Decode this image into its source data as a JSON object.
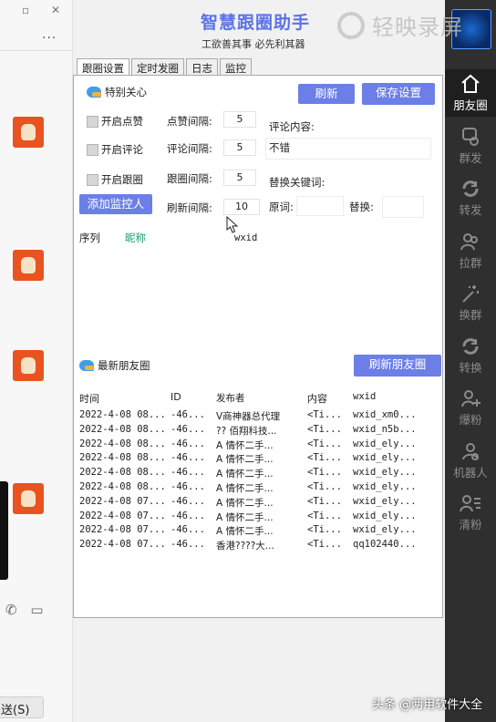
{
  "left_window": {
    "dots": "...",
    "send_button": "送(S)"
  },
  "app": {
    "title": "智慧跟圈助手",
    "subtitle": "工欲善其事 必先利其器"
  },
  "tabs": [
    "跟圈设置",
    "定时发圈",
    "日志",
    "监控"
  ],
  "special_care": {
    "header": "特别关心",
    "refresh_button": "刷新",
    "save_button": "保存设置",
    "like": {
      "label": "开启点赞",
      "interval_label": "点赞间隔:",
      "interval": "5"
    },
    "comment": {
      "label": "开启评论",
      "interval_label": "评论间隔:",
      "interval": "5"
    },
    "follow": {
      "label": "开启跟圈",
      "interval_label": "跟圈间隔:",
      "interval": "5"
    },
    "add_monitor_button": "添加监控人",
    "refresh_interval_label": "刷新间隔:",
    "refresh_interval": "10",
    "comment_content_label": "评论内容:",
    "comment_content": "不错",
    "replace_keyword_label": "替换关键词:",
    "original_label": "原词:",
    "original_value": "",
    "replace_label": "替换:",
    "replace_value": "",
    "list_columns": [
      "序列",
      "昵称",
      "wxid"
    ]
  },
  "latest_moments": {
    "header": "最新朋友圈",
    "refresh_button": "刷新朋友圈",
    "columns": [
      "时间",
      "ID",
      "发布者",
      "内容",
      "wxid"
    ],
    "rows": [
      [
        "2022-4-08 08...",
        "-46...",
        "V商神器总代理",
        "<Ti...",
        "wxid_xm0..."
      ],
      [
        "2022-4-08 08...",
        "-46...",
        "?? 佰翔科技...",
        "<Ti...",
        "wxid_n5b..."
      ],
      [
        "2022-4-08 08...",
        "-46...",
        "A 情怀二手...",
        "<Ti...",
        "wxid_ely..."
      ],
      [
        "2022-4-08 08...",
        "-46...",
        "A 情怀二手...",
        "<Ti...",
        "wxid_ely..."
      ],
      [
        "2022-4-08 08...",
        "-46...",
        "A 情怀二手...",
        "<Ti...",
        "wxid_ely..."
      ],
      [
        "2022-4-08 08...",
        "-46...",
        "A 情怀二手...",
        "<Ti...",
        "wxid_ely..."
      ],
      [
        "2022-4-08 07...",
        "-46...",
        "A 情怀二手...",
        "<Ti...",
        "wxid_ely..."
      ],
      [
        "2022-4-08 07...",
        "-46...",
        "A 情怀二手...",
        "<Ti...",
        "wxid_ely..."
      ],
      [
        "2022-4-08 07...",
        "-46...",
        "A 情怀二手...",
        "<Ti...",
        "wxid_ely..."
      ],
      [
        "2022-4-08 07...",
        "-46...",
        "香港????大...",
        "<Ti...",
        "qq102440..."
      ]
    ]
  },
  "sidebar": {
    "items": [
      {
        "label": "朋友圈",
        "icon": "home-icon",
        "active": true
      },
      {
        "label": "群发",
        "icon": "chat-bubble-icon",
        "active": false
      },
      {
        "label": "转发",
        "icon": "refresh-icon",
        "active": false
      },
      {
        "label": "拉群",
        "icon": "group-icon",
        "active": false
      },
      {
        "label": "换群",
        "icon": "magic-wand-icon",
        "active": false
      },
      {
        "label": "转换",
        "icon": "refresh-icon",
        "active": false
      },
      {
        "label": "爆粉",
        "icon": "add-user-icon",
        "active": false
      },
      {
        "label": "机器人",
        "icon": "robot-icon",
        "active": false
      },
      {
        "label": "清粉",
        "icon": "user-list-icon",
        "active": false
      }
    ]
  },
  "watermarks": {
    "recorder": "轻映录屏",
    "source": "头条 @两用软件大全"
  },
  "colors": {
    "accent": "#6c7fe6",
    "title": "#5b73e8",
    "sidebar_bg": "#2f2f2f",
    "link_green": "#1a9e6e"
  }
}
